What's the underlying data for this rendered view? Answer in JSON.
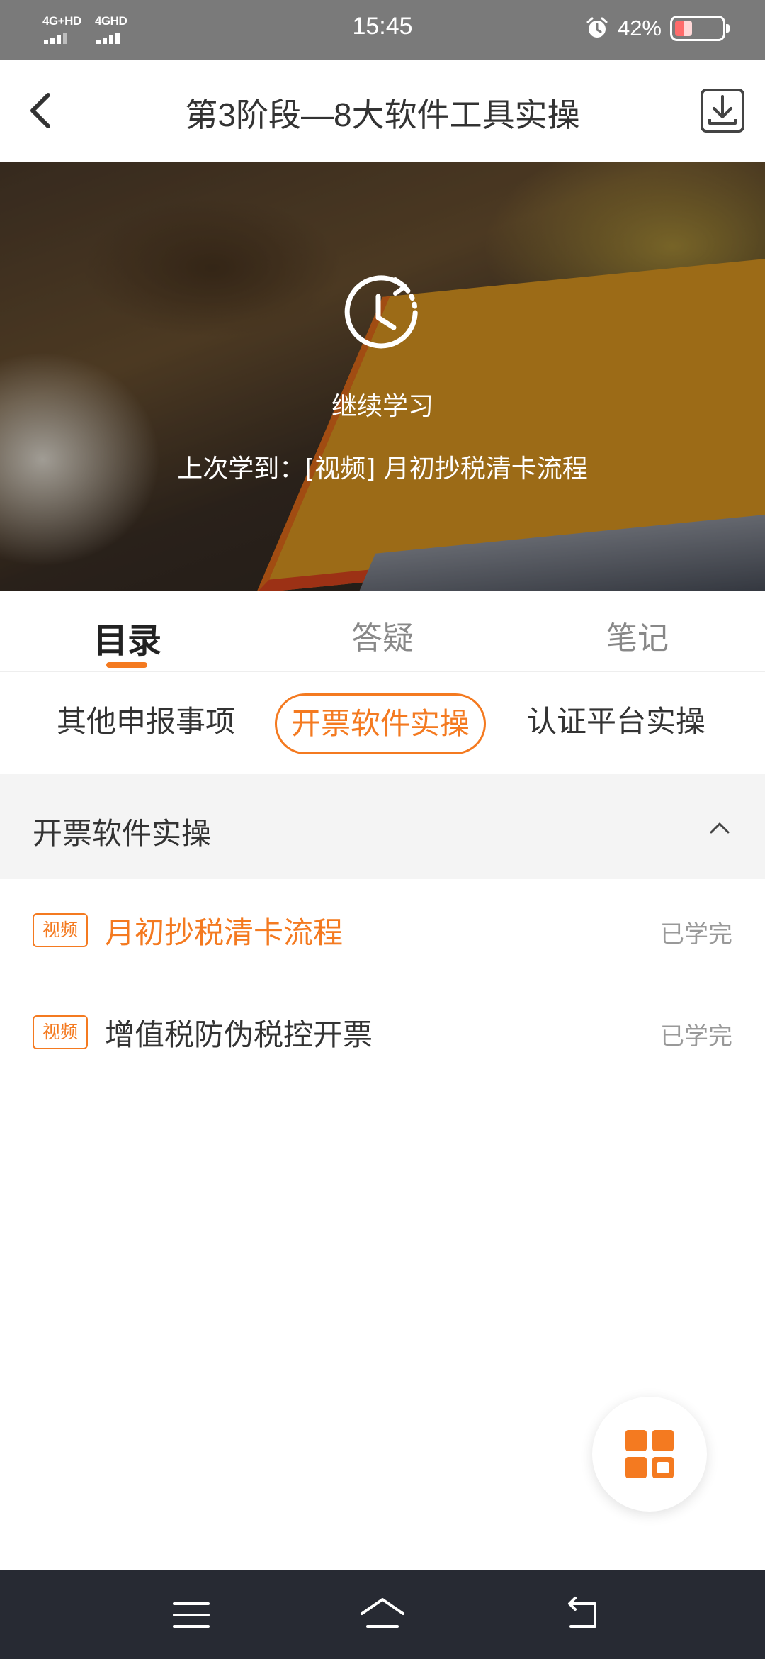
{
  "status_bar": {
    "time": "15:45",
    "signal1": "4G+HD",
    "signal2": "4GHD",
    "battery_percent": "42%",
    "battery_level": 0.42
  },
  "header": {
    "title": "第3阶段—8大软件工具实操"
  },
  "hero": {
    "continue_label": "继续学习",
    "last_learned": "上次学到：[视频] 月初抄税清卡流程"
  },
  "tabs": [
    {
      "label": "目录",
      "active": true
    },
    {
      "label": "答疑",
      "active": false
    },
    {
      "label": "笔记",
      "active": false
    }
  ],
  "chips": [
    {
      "label": "其他申报事项",
      "active": false
    },
    {
      "label": "开票软件实操",
      "active": true
    },
    {
      "label": "认证平台实操",
      "active": false
    }
  ],
  "section": {
    "title": "开票软件实操",
    "lessons": [
      {
        "badge": "视频",
        "title": "月初抄税清卡流程",
        "status": "已学完",
        "current": true
      },
      {
        "badge": "视频",
        "title": "增值税防伪税控开票",
        "status": "已学完",
        "current": false
      }
    ]
  },
  "colors": {
    "accent": "#f47a20",
    "nav_bar": "#272a33",
    "section_bg": "#f4f4f4"
  },
  "icons": {
    "back": "chevron-left-icon",
    "download": "download-icon",
    "continue": "history-clock-icon",
    "collapse": "chevron-up-icon",
    "fab": "grid-icon",
    "nav_menu": "menu-icon",
    "nav_home": "home-icon",
    "nav_back": "back-icon"
  }
}
